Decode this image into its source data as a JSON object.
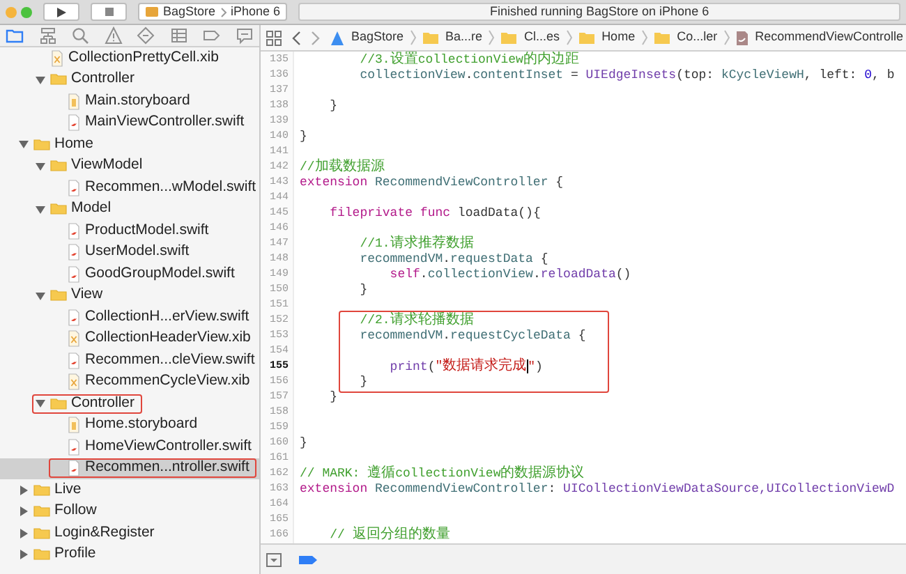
{
  "toolbar": {
    "scheme": "BagStore",
    "device": "iPhone 6",
    "status": "Finished running BagStore on iPhone 6"
  },
  "navigator_tabs": [
    {
      "kind": "folder",
      "selected": true
    },
    {
      "kind": "hierarchy",
      "selected": false
    },
    {
      "kind": "search",
      "selected": false
    },
    {
      "kind": "warning",
      "selected": false
    },
    {
      "kind": "diamond",
      "selected": false
    },
    {
      "kind": "list",
      "selected": false
    },
    {
      "kind": "tag",
      "selected": false
    },
    {
      "kind": "bubble",
      "selected": false
    }
  ],
  "tree": [
    {
      "children": [
        {
          "label": "CollectionPrettyCell.xib",
          "kind": "xib",
          "selected": false,
          "boxed": false
        },
        {
          "label": "Controller",
          "kind": "folder",
          "expanded": true,
          "boxed": false,
          "children": [
            {
              "label": "Main.storyboard",
              "kind": "storyboard",
              "selected": false,
              "boxed": false
            },
            {
              "label": "MainViewController.swift",
              "kind": "swift",
              "selected": false,
              "boxed": false
            }
          ]
        }
      ]
    },
    {
      "label": "Home",
      "kind": "folder",
      "expanded": true,
      "boxed": false,
      "children": [
        {
          "label": "ViewModel",
          "kind": "folder",
          "expanded": true,
          "boxed": false,
          "children": [
            {
              "label": "Recommen...wModel.swift",
              "kind": "swift",
              "selected": false,
              "boxed": false
            }
          ]
        },
        {
          "label": "Model",
          "kind": "folder",
          "expanded": true,
          "boxed": false,
          "children": [
            {
              "label": "ProductModel.swift",
              "kind": "swift",
              "selected": false,
              "boxed": false
            },
            {
              "label": "UserModel.swift",
              "kind": "swift",
              "selected": false,
              "boxed": false
            },
            {
              "label": "GoodGroupModel.swift",
              "kind": "swift",
              "selected": false,
              "boxed": false
            }
          ]
        },
        {
          "label": "View",
          "kind": "folder",
          "expanded": true,
          "boxed": false,
          "children": [
            {
              "label": "CollectionH...erView.swift",
              "kind": "swift",
              "selected": false,
              "boxed": false
            },
            {
              "label": "CollectionHeaderView.xib",
              "kind": "xib",
              "selected": false,
              "boxed": false
            },
            {
              "label": "Recommen...cleView.swift",
              "kind": "swift",
              "selected": false,
              "boxed": false
            },
            {
              "label": "RecommenCycleView.xib",
              "kind": "xib",
              "selected": false,
              "boxed": false
            }
          ]
        },
        {
          "label": "Controller",
          "kind": "folder",
          "expanded": true,
          "boxed": true,
          "children": [
            {
              "label": "Home.storyboard",
              "kind": "storyboard",
              "selected": false,
              "boxed": false
            },
            {
              "label": "HomeViewController.swift",
              "kind": "swift",
              "selected": false,
              "boxed": false
            },
            {
              "label": "Recommen...ntroller.swift",
              "kind": "swift",
              "selected": true,
              "boxed": true
            }
          ]
        }
      ]
    },
    {
      "label": "Live",
      "kind": "folder",
      "expanded": false,
      "boxed": false
    },
    {
      "label": "Follow",
      "kind": "folder",
      "expanded": false,
      "boxed": false
    },
    {
      "label": "Login&Register",
      "kind": "folder",
      "expanded": false,
      "boxed": false
    },
    {
      "label": "Profile",
      "kind": "folder",
      "expanded": false,
      "boxed": false
    }
  ],
  "jump_bar": [
    {
      "label": "BagStore",
      "kind": "project"
    },
    {
      "label": "Ba...re",
      "kind": "folder"
    },
    {
      "label": "Cl...es",
      "kind": "folder"
    },
    {
      "label": "Home",
      "kind": "folder"
    },
    {
      "label": "Co...ler",
      "kind": "folder"
    },
    {
      "label": "RecommendViewControlle",
      "kind": "swift"
    }
  ],
  "code": [
    {
      "number": "135",
      "current": false,
      "tokens": [
        {
          "kind": "comment",
          "text": "        //3.设置collectionView的内边距"
        }
      ]
    },
    {
      "number": "136",
      "current": false,
      "tokens": [
        {
          "kind": "project",
          "text": "        collectionView"
        },
        {
          "kind": "plain",
          "text": "."
        },
        {
          "kind": "project",
          "text": "contentInset"
        },
        {
          "kind": "plain",
          "text": " = "
        },
        {
          "kind": "type",
          "text": "UIEdgeInsets"
        },
        {
          "kind": "plain",
          "text": "(top: "
        },
        {
          "kind": "project",
          "text": "kCycleViewH"
        },
        {
          "kind": "plain",
          "text": ", left: "
        },
        {
          "kind": "number",
          "text": "0"
        },
        {
          "kind": "plain",
          "text": ", b"
        }
      ]
    },
    {
      "number": "137",
      "current": false
    },
    {
      "number": "138",
      "current": false,
      "tokens": [
        {
          "kind": "plain",
          "text": "    }"
        }
      ]
    },
    {
      "number": "139",
      "current": false
    },
    {
      "number": "140",
      "current": false,
      "tokens": [
        {
          "kind": "plain",
          "text": "}"
        }
      ]
    },
    {
      "number": "141",
      "current": false
    },
    {
      "number": "142",
      "current": false,
      "tokens": [
        {
          "kind": "comment",
          "text": "//加载数据源"
        }
      ]
    },
    {
      "number": "143",
      "current": false,
      "tokens": [
        {
          "kind": "keyword",
          "text": "extension"
        },
        {
          "kind": "project",
          "text": " RecommendViewController"
        },
        {
          "kind": "plain",
          "text": " {"
        }
      ]
    },
    {
      "number": "144",
      "current": false
    },
    {
      "number": "145",
      "current": false,
      "tokens": [
        {
          "kind": "keyword",
          "text": "    fileprivate func"
        },
        {
          "kind": "plain",
          "text": " loadData(){"
        }
      ]
    },
    {
      "number": "146",
      "current": false
    },
    {
      "number": "147",
      "current": false,
      "tokens": [
        {
          "kind": "comment",
          "text": "        //1.请求推荐数据"
        }
      ]
    },
    {
      "number": "148",
      "current": false,
      "tokens": [
        {
          "kind": "project",
          "text": "        recommendVM"
        },
        {
          "kind": "plain",
          "text": "."
        },
        {
          "kind": "project",
          "text": "requestData"
        },
        {
          "kind": "plain",
          "text": " {"
        }
      ]
    },
    {
      "number": "149",
      "current": false,
      "tokens": [
        {
          "kind": "keyword",
          "text": "            self"
        },
        {
          "kind": "plain",
          "text": "."
        },
        {
          "kind": "project",
          "text": "collectionView"
        },
        {
          "kind": "plain",
          "text": "."
        },
        {
          "kind": "type",
          "text": "reloadData"
        },
        {
          "kind": "plain",
          "text": "()"
        }
      ]
    },
    {
      "number": "150",
      "current": false,
      "tokens": [
        {
          "kind": "plain",
          "text": "        }"
        }
      ]
    },
    {
      "number": "151",
      "current": false
    },
    {
      "kind": "annotation",
      "lines": [
        {
          "number": "152",
          "current": false,
          "tokens": [
            {
              "kind": "comment",
              "text": "        //2.请求轮播数据"
            }
          ]
        },
        {
          "number": "153",
          "current": false,
          "tokens": [
            {
              "kind": "project",
              "text": "        recommendVM"
            },
            {
              "kind": "plain",
              "text": "."
            },
            {
              "kind": "project",
              "text": "requestCycleData"
            },
            {
              "kind": "plain",
              "text": " {"
            }
          ]
        },
        {
          "number": "154",
          "current": false
        },
        {
          "number": "155",
          "current": true,
          "tokens": [
            {
              "kind": "type",
              "text": "            print"
            },
            {
              "kind": "plain",
              "text": "("
            },
            {
              "kind": "string",
              "text": "\"数据请求完成",
              "caret": true
            },
            {
              "kind": "string",
              "text": "\""
            },
            {
              "kind": "plain",
              "text": ")"
            }
          ]
        },
        {
          "number": "156",
          "current": false,
          "tokens": [
            {
              "kind": "plain",
              "text": "        }"
            }
          ]
        }
      ]
    },
    {
      "number": "157",
      "current": false,
      "tokens": [
        {
          "kind": "plain",
          "text": "    }"
        }
      ]
    },
    {
      "number": "158",
      "current": false
    },
    {
      "number": "159",
      "current": false
    },
    {
      "number": "160",
      "current": false,
      "tokens": [
        {
          "kind": "plain",
          "text": "}"
        }
      ]
    },
    {
      "number": "161",
      "current": false
    },
    {
      "number": "162",
      "current": false,
      "tokens": [
        {
          "kind": "comment",
          "text": "// MARK: 遵循collectionView的数据源协议"
        }
      ]
    },
    {
      "number": "163",
      "current": false,
      "tokens": [
        {
          "kind": "keyword",
          "text": "extension"
        },
        {
          "kind": "project",
          "text": " RecommendViewController"
        },
        {
          "kind": "plain",
          "text": ": "
        },
        {
          "kind": "type",
          "text": "UICollectionViewDataSource,UICollectionViewD"
        }
      ]
    },
    {
      "number": "164",
      "current": false
    },
    {
      "number": "165",
      "current": false
    },
    {
      "number": "166",
      "current": false,
      "tokens": [
        {
          "kind": "comment",
          "text": "    // 返回分组的数量"
        }
      ]
    }
  ]
}
